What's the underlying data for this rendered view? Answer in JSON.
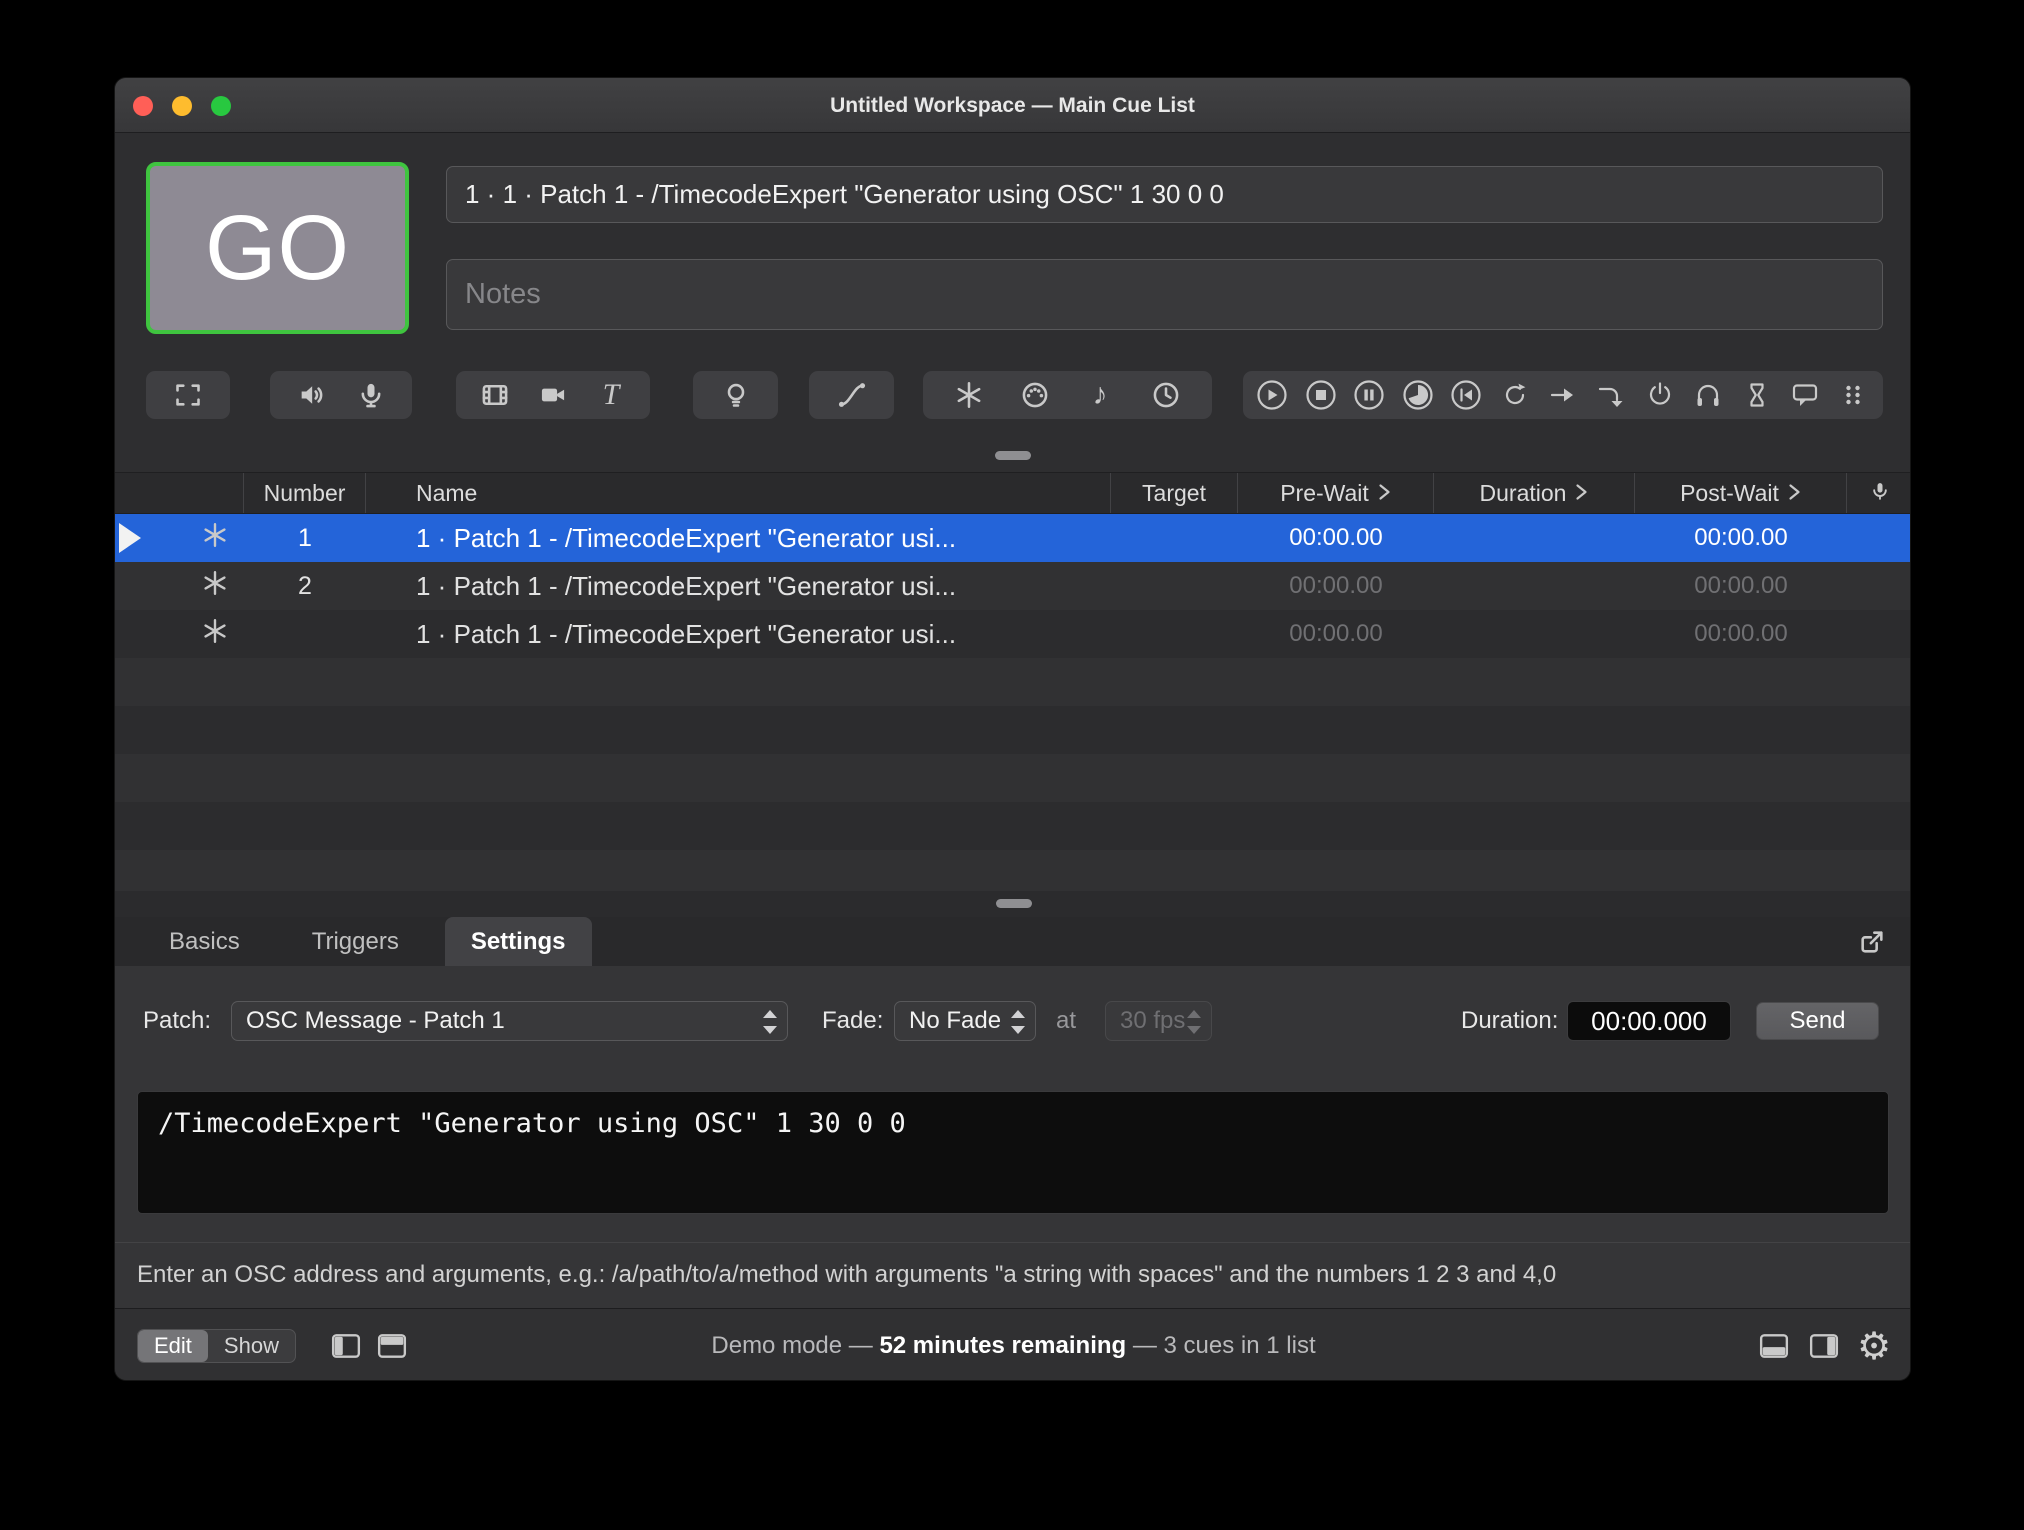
{
  "colors": {
    "selection_blue": "#2464d9",
    "go_border_green": "#3fc43f",
    "traffic_red": "#ff5f57",
    "traffic_yellow": "#febc2e",
    "traffic_green": "#28c840"
  },
  "titlebar": {
    "title": "Untitled Workspace — Main Cue List"
  },
  "header": {
    "go_label": "GO",
    "cue_title": "1 · 1 · Patch 1 - /TimecodeExpert \"Generator using OSC\" 1 30 0 0",
    "notes_value": "",
    "notes_placeholder": "Notes"
  },
  "cue_list": {
    "columns": {
      "number": "Number",
      "name": "Name",
      "target": "Target",
      "pre_wait": "Pre-Wait",
      "duration": "Duration",
      "post_wait": "Post-Wait"
    },
    "rows": [
      {
        "number": "1",
        "name": "1 · Patch 1 - /TimecodeExpert \"Generator usi...",
        "target": "",
        "pre_wait": "00:00.00",
        "duration": "",
        "post_wait": "00:00.00",
        "selected": true
      },
      {
        "number": "2",
        "name": "1 · Patch 1 - /TimecodeExpert \"Generator usi...",
        "target": "",
        "pre_wait": "00:00.00",
        "duration": "",
        "post_wait": "00:00.00",
        "selected": false
      },
      {
        "number": "",
        "name": "1 · Patch 1 - /TimecodeExpert \"Generator usi...",
        "target": "",
        "pre_wait": "00:00.00",
        "duration": "",
        "post_wait": "00:00.00",
        "selected": false
      }
    ]
  },
  "inspector": {
    "tabs": {
      "basics": "Basics",
      "triggers": "Triggers",
      "settings": "Settings"
    },
    "active_tab": "Settings",
    "settings": {
      "patch_label": "Patch:",
      "patch_value": "OSC Message - Patch 1",
      "fade_label": "Fade:",
      "fade_value": "No Fade",
      "at_label": "at",
      "fps_value": "30 fps",
      "duration_label": "Duration:",
      "duration_value": "00:00.000",
      "send_label": "Send",
      "osc_message": "/TimecodeExpert \"Generator using OSC\" 1 30 0 0",
      "help_text": "Enter an OSC address and arguments, e.g.: /a/path/to/a/method with arguments \"a string with spaces\" and the numbers 1 2 3 and 4,0"
    }
  },
  "status_bar": {
    "edit_label": "Edit",
    "show_label": "Show",
    "demo_prefix": "Demo mode — ",
    "demo_bold": "52 minutes remaining",
    "demo_suffix": " — 3 cues in 1 list"
  }
}
